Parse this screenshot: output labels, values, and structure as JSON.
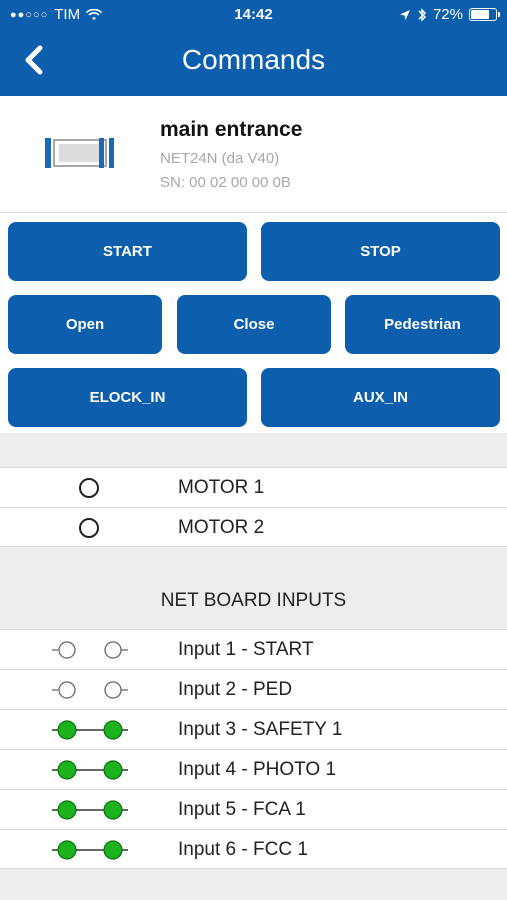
{
  "status_bar": {
    "carrier": "TIM",
    "time": "14:42",
    "battery": "72%"
  },
  "nav": {
    "title": "Commands",
    "back_icon": "chevron-left-icon"
  },
  "device": {
    "name": "main entrance",
    "model": "NET24N (da V40)",
    "serial": "SN: 00 02 00 00 0B"
  },
  "commands": {
    "start": "START",
    "stop": "STOP",
    "open": "Open",
    "close": "Close",
    "pedestrian": "Pedestrian",
    "elock_in": "ELOCK_IN",
    "aux_in": "AUX_IN"
  },
  "motors": [
    {
      "label": "MOTOR 1"
    },
    {
      "label": "MOTOR 2"
    }
  ],
  "inputs_section": {
    "title": "NET BOARD INPUTS"
  },
  "inputs": [
    {
      "label": "Input 1 - START",
      "state": "open"
    },
    {
      "label": "Input 2 - PED",
      "state": "open"
    },
    {
      "label": "Input 3 - SAFETY 1",
      "state": "closed"
    },
    {
      "label": "Input 4 - PHOTO 1",
      "state": "closed"
    },
    {
      "label": "Input 5 - FCA 1",
      "state": "closed"
    },
    {
      "label": "Input 6 - FCC 1",
      "state": "closed"
    }
  ],
  "colors": {
    "primary": "#0d5fae",
    "active_input": "#1db31d"
  }
}
